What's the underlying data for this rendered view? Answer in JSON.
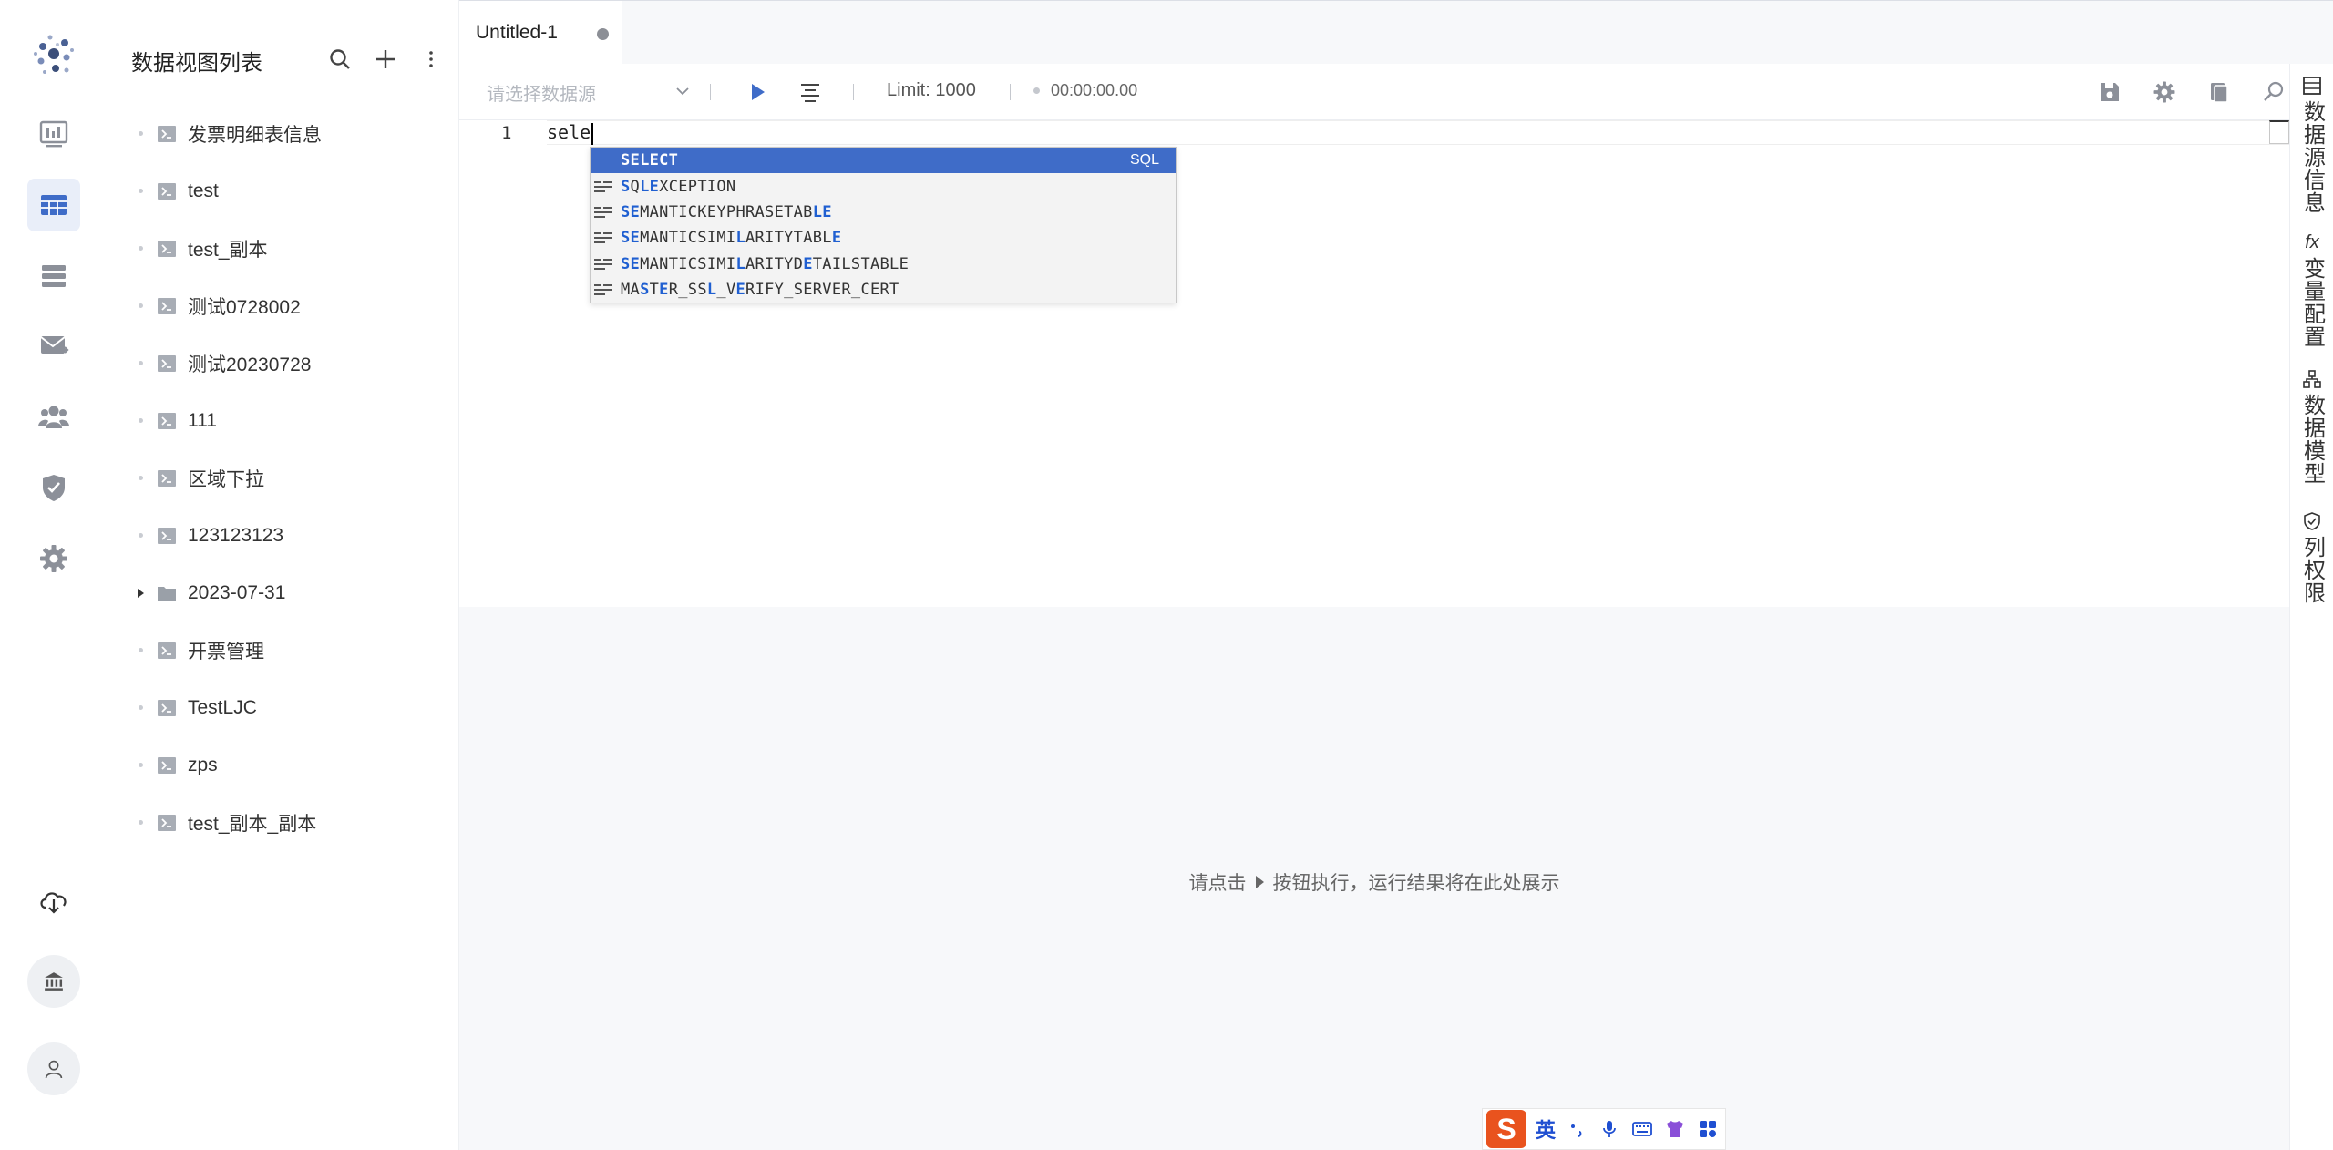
{
  "sidebar": {
    "title": "数据视图列表",
    "items": [
      {
        "label": "发票明细表信息",
        "type": "view"
      },
      {
        "label": "test",
        "type": "view"
      },
      {
        "label": "test_副本",
        "type": "view"
      },
      {
        "label": "测试0728002",
        "type": "view"
      },
      {
        "label": "测试20230728",
        "type": "view"
      },
      {
        "label": "111",
        "type": "view"
      },
      {
        "label": "区域下拉",
        "type": "view"
      },
      {
        "label": "123123123",
        "type": "view"
      },
      {
        "label": "2023-07-31",
        "type": "folder"
      },
      {
        "label": "开票管理",
        "type": "view"
      },
      {
        "label": "TestLJC",
        "type": "view"
      },
      {
        "label": "zps",
        "type": "view"
      },
      {
        "label": "test_副本_副本",
        "type": "view"
      }
    ]
  },
  "tabs": [
    {
      "label": "Untitled-1",
      "modified": true
    }
  ],
  "toolbar": {
    "datasource_placeholder": "请选择数据源",
    "limit": "Limit: 1000",
    "elapsed": "00:00:00.00"
  },
  "editor": {
    "line_number": "1",
    "code": "sele"
  },
  "suggest": {
    "selected": {
      "label": "SELECT",
      "detail": "SQL"
    },
    "items": [
      "SQLEXCEPTION",
      "SEMANTICKEYPHRASETABLE",
      "SEMANTICSIMILARITYTABLE",
      "SEMANTICSIMILARITYDETAILSTABLE",
      "MASTER_SSL_VERIFY_SERVER_CERT"
    ]
  },
  "result": {
    "hint_before": "请点击",
    "hint_after": "按钮执行，运行结果将在此处展示"
  },
  "right_panel": [
    {
      "label": "数据源信息",
      "icon": "list-icon"
    },
    {
      "label": "变量配置",
      "icon": "fx-icon",
      "icon_text": "fx"
    },
    {
      "label": "数据模型",
      "icon": "model-icon"
    },
    {
      "label": "列权限",
      "icon": "shield-check-icon"
    }
  ],
  "ime": {
    "mode": "英"
  },
  "colors": {
    "accent": "#3f6cc8",
    "active_nav": "#e9eef9",
    "icon_gray": "#8c9099"
  }
}
